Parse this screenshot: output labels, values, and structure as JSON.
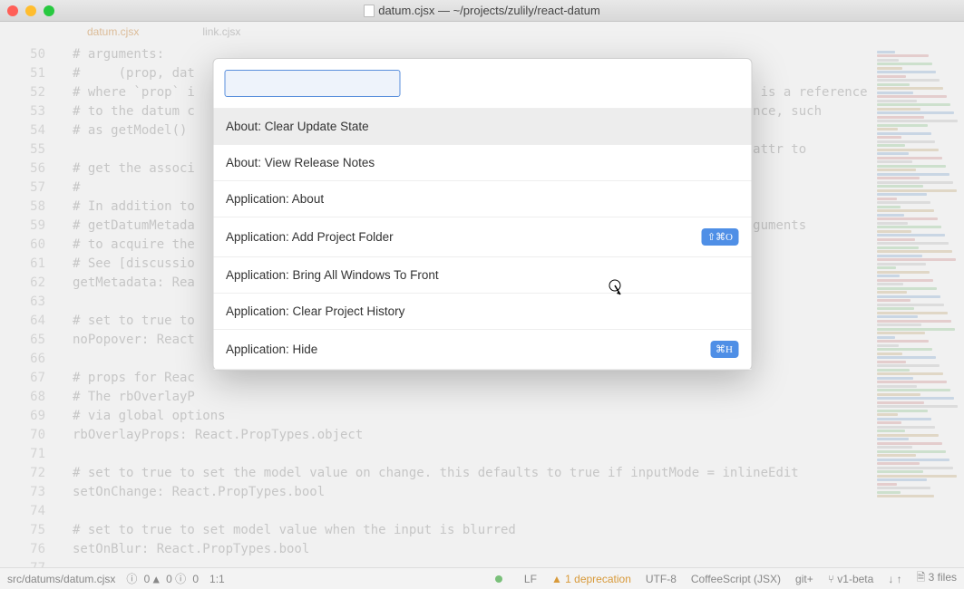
{
  "window": {
    "title": "datum.cjsx — ~/projects/zulily/react-datum"
  },
  "tabs": [
    {
      "label": "datum.cjsx",
      "active": true
    },
    {
      "label": "link.cjsx",
      "active": false
    }
  ],
  "gutter_start": 50,
  "code_lines": [
    "# arguments:",
    "#     (prop, dat",
    "# where `prop` i                                                                        ` is a reference",
    "# to the datum c                                                                        ance, such",
    "# as getModel() ",
    "                                                                                        .attr to",
    "# get the associ",
    "#",
    "# In addition to",
    "# getDatumMetada                                                                         guments",
    "# to acquire the",
    "# See [discussio",
    "getMetadata: Rea",
    "",
    "# set to true to",
    "noPopover: React",
    "",
    "# props for Reac",
    "# The rbOverlayP",
    "# via global options",
    "rbOverlayProps: React.PropTypes.object",
    "",
    "# set to true to set the model value on change. this defaults to true if inputMode = inlineEdit",
    "setOnChange: React.PropTypes.bool",
    "",
    "# set to true to set model value when the input is blurred",
    "setOnBlur: React.PropTypes.bool",
    ""
  ],
  "keyword_lines": {
    "11": "getMetadata:",
    "14": "noPopover:",
    "19": "rbOverlayProps:",
    "22": "setOnChange:",
    "25": "setOnBlur:"
  },
  "palette": {
    "placeholder": "",
    "items": [
      {
        "label": "About: Clear Update State",
        "shortcut": "",
        "selected": true
      },
      {
        "label": "About: View Release Notes",
        "shortcut": "",
        "selected": false
      },
      {
        "label": "Application: About",
        "shortcut": "",
        "selected": false
      },
      {
        "label": "Application: Add Project Folder",
        "shortcut": "⇧⌘O",
        "selected": false
      },
      {
        "label": "Application: Bring All Windows To Front",
        "shortcut": "",
        "selected": false
      },
      {
        "label": "Application: Clear Project History",
        "shortcut": "",
        "selected": false
      },
      {
        "label": "Application: Hide",
        "shortcut": "⌘H",
        "selected": false
      }
    ]
  },
  "status": {
    "path": "src/datums/datum.cjsx",
    "diagnostics": "0",
    "warnings": "0",
    "info": "0",
    "cursor": "1:1",
    "line_ending": "LF",
    "deprecation": "1 deprecation",
    "encoding": "UTF-8",
    "grammar": "CoffeeScript (JSX)",
    "git_label": "git+",
    "branch": "v1-beta",
    "files": "3 files"
  }
}
